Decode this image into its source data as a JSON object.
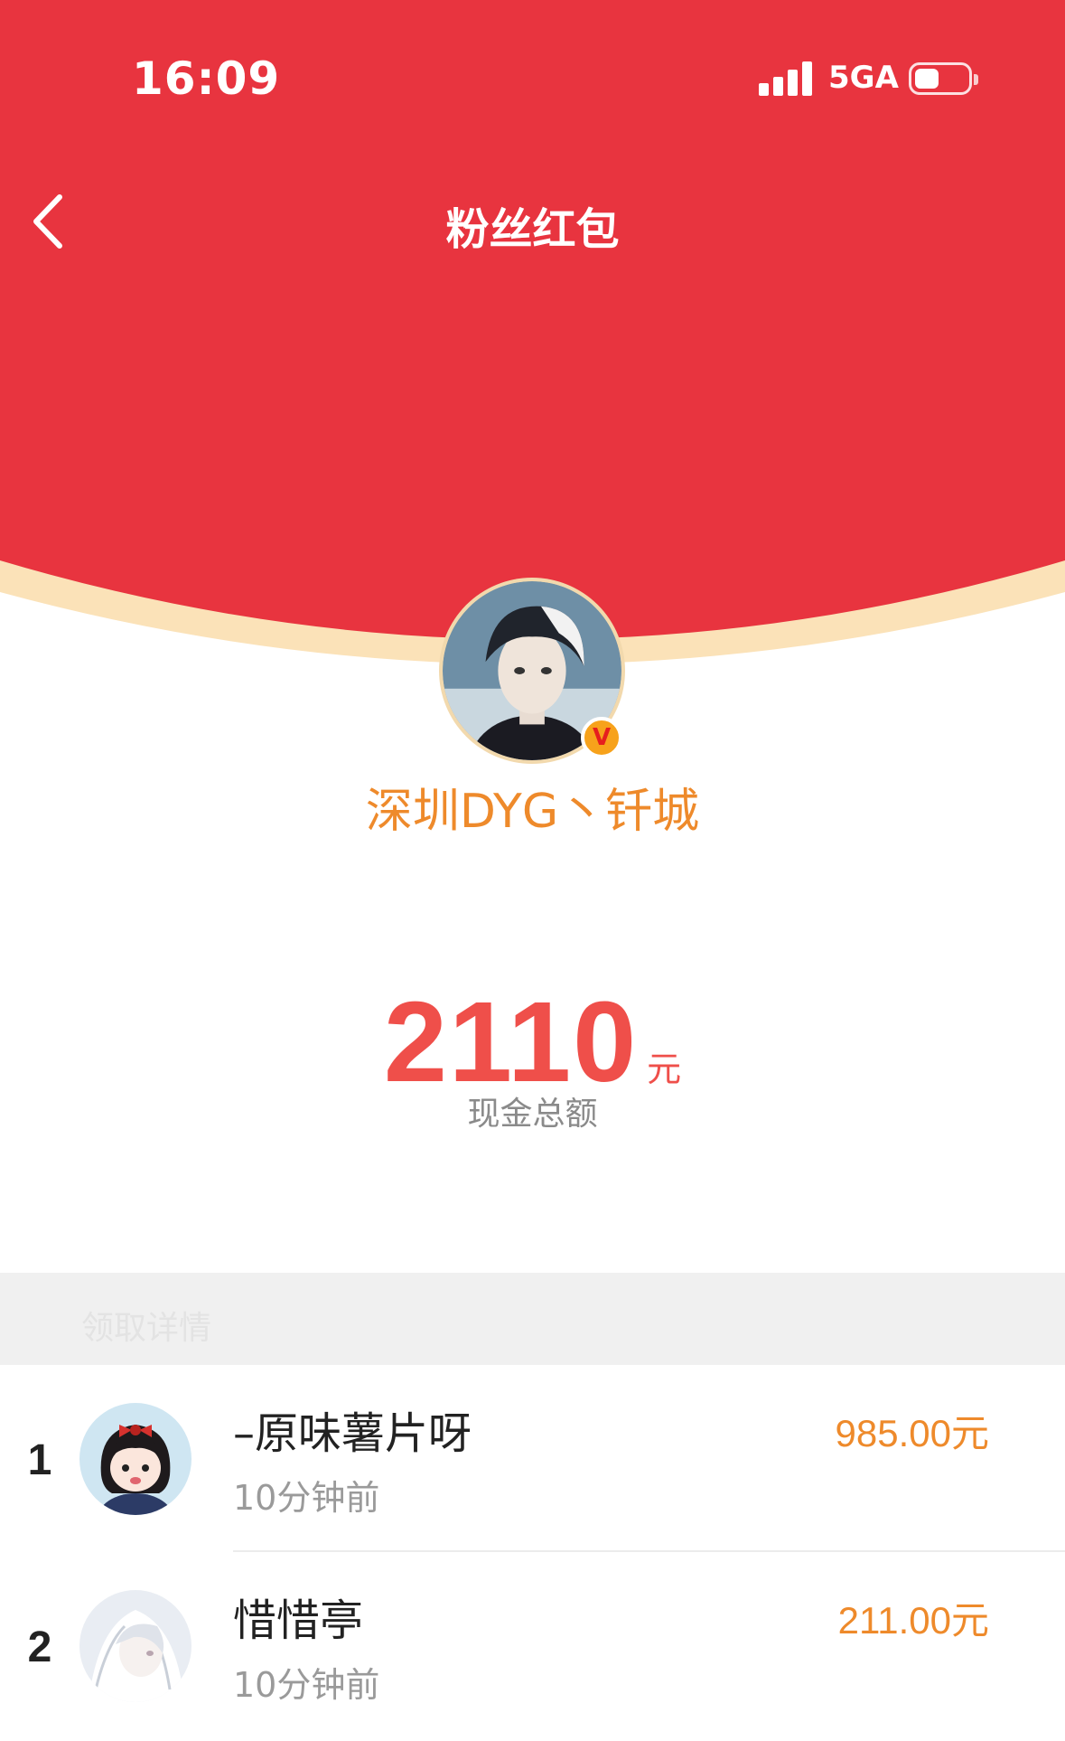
{
  "status_bar": {
    "time": "16:09",
    "network": "5GA",
    "signal_icon": "signal-bars-icon",
    "battery_icon": "battery-icon"
  },
  "nav": {
    "title": "粉丝红包",
    "back_icon": "chevron-left-icon"
  },
  "sender": {
    "name": "深圳DYG丶钎城",
    "verified_badge": "V"
  },
  "total": {
    "amount": "2110",
    "unit": "元",
    "label": "现金总额"
  },
  "section_label": "领取详情",
  "recipients": [
    {
      "rank": "1",
      "name": "–原味薯片呀",
      "time": "10分钟前",
      "amount": "985.00元"
    },
    {
      "rank": "2",
      "name": "惜惜亭",
      "time": "10分钟前",
      "amount": "211.00元"
    }
  ],
  "colors": {
    "header_red": "#e8343f",
    "cream_arc": "#fbe2b8",
    "accent_orange": "#ee8a2b",
    "amount_red": "#ef4f4a"
  }
}
